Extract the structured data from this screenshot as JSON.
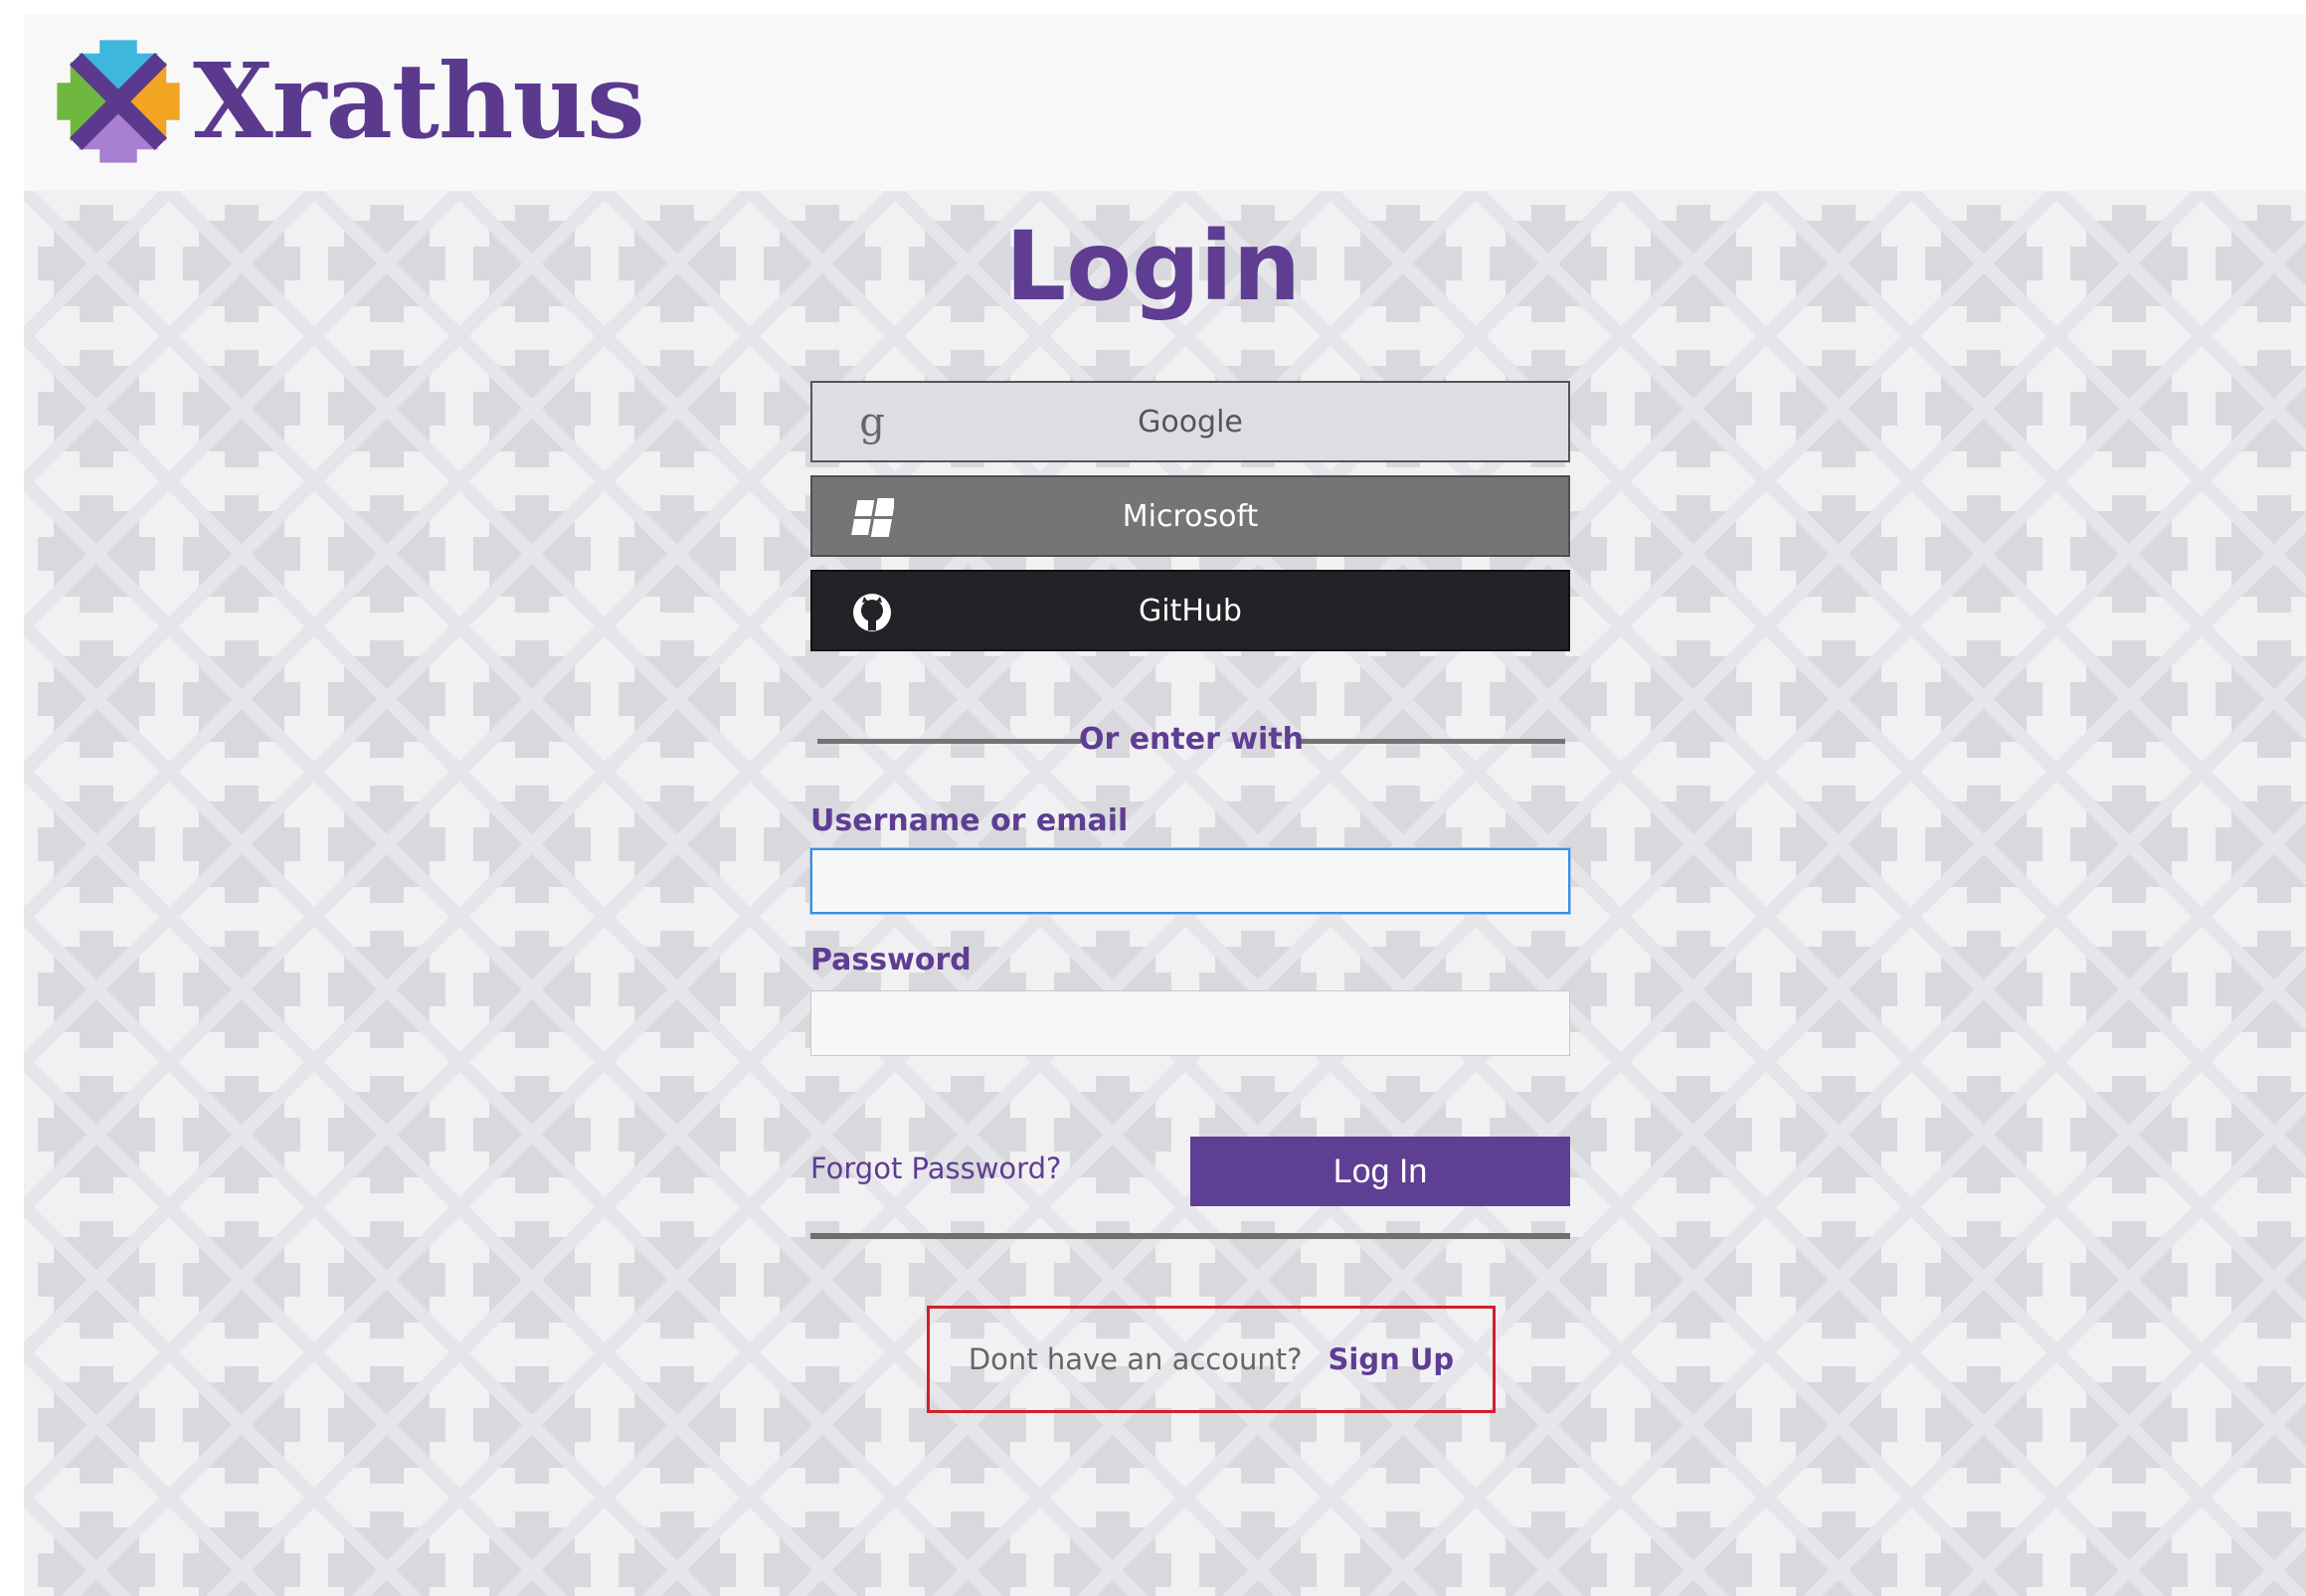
{
  "brand": {
    "name": "Xrathus",
    "logo_colors": [
      "#5b3a8e",
      "#6fb83f",
      "#f2a522",
      "#3fb6de",
      "#a97fd1"
    ]
  },
  "login": {
    "title": "Login",
    "providers": [
      {
        "label": "Google",
        "icon": "google-g-icon"
      },
      {
        "label": "Microsoft",
        "icon": "windows-icon"
      },
      {
        "label": "GitHub",
        "icon": "github-icon"
      }
    ],
    "divider_text": "Or enter with",
    "username": {
      "label": "Username or email",
      "value": "",
      "placeholder": ""
    },
    "password": {
      "label": "Password",
      "value": "",
      "placeholder": ""
    },
    "forgot_label": "Forgot Password?",
    "submit_label": "Log In"
  },
  "signup": {
    "prompt": "Dont have an account?",
    "link_label": "Sign Up"
  },
  "colors": {
    "accent": "#5f3d93",
    "highlight_box": "#d0202a",
    "focus_ring": "#3a8fe0"
  }
}
